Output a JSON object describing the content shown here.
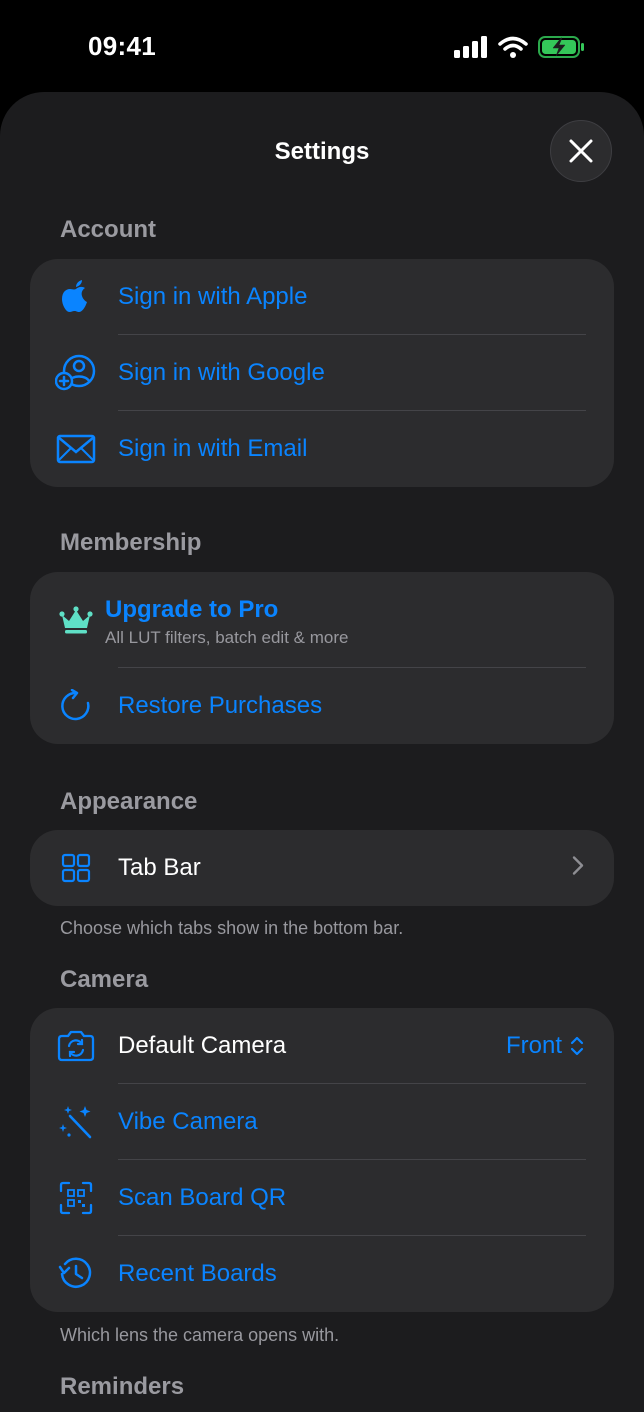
{
  "status": {
    "time": "09:41"
  },
  "title": "Settings",
  "sections": {
    "account": {
      "header": "Account",
      "items": [
        {
          "label": "Sign in with Apple",
          "icon": "apple-logo-icon"
        },
        {
          "label": "Sign in with Google",
          "icon": "person-add-icon"
        },
        {
          "label": "Sign in with Email",
          "icon": "envelope-icon"
        }
      ]
    },
    "membership": {
      "header": "Membership",
      "pro_title": "Upgrade to Pro",
      "pro_subtitle": "All LUT filters, batch edit & more",
      "restore_label": "Restore Purchases"
    },
    "appearance": {
      "header": "Appearance",
      "tab_bar_label": "Tab Bar",
      "footer": "Choose which tabs show in the bottom bar."
    },
    "camera": {
      "header": "Camera",
      "default_camera_label": "Default Camera",
      "default_camera_value": "Front",
      "vibe_label": "Vibe Camera",
      "scan_label": "Scan Board QR",
      "recent_label": "Recent Boards",
      "footer": "Which lens the camera opens with."
    },
    "reminders": {
      "header": "Reminders"
    }
  },
  "colors": {
    "accent": "#0a84ff",
    "crown": "#5fe0c6",
    "battery": "#34c759",
    "background": "#1c1c1e",
    "card": "#2c2c2e"
  }
}
